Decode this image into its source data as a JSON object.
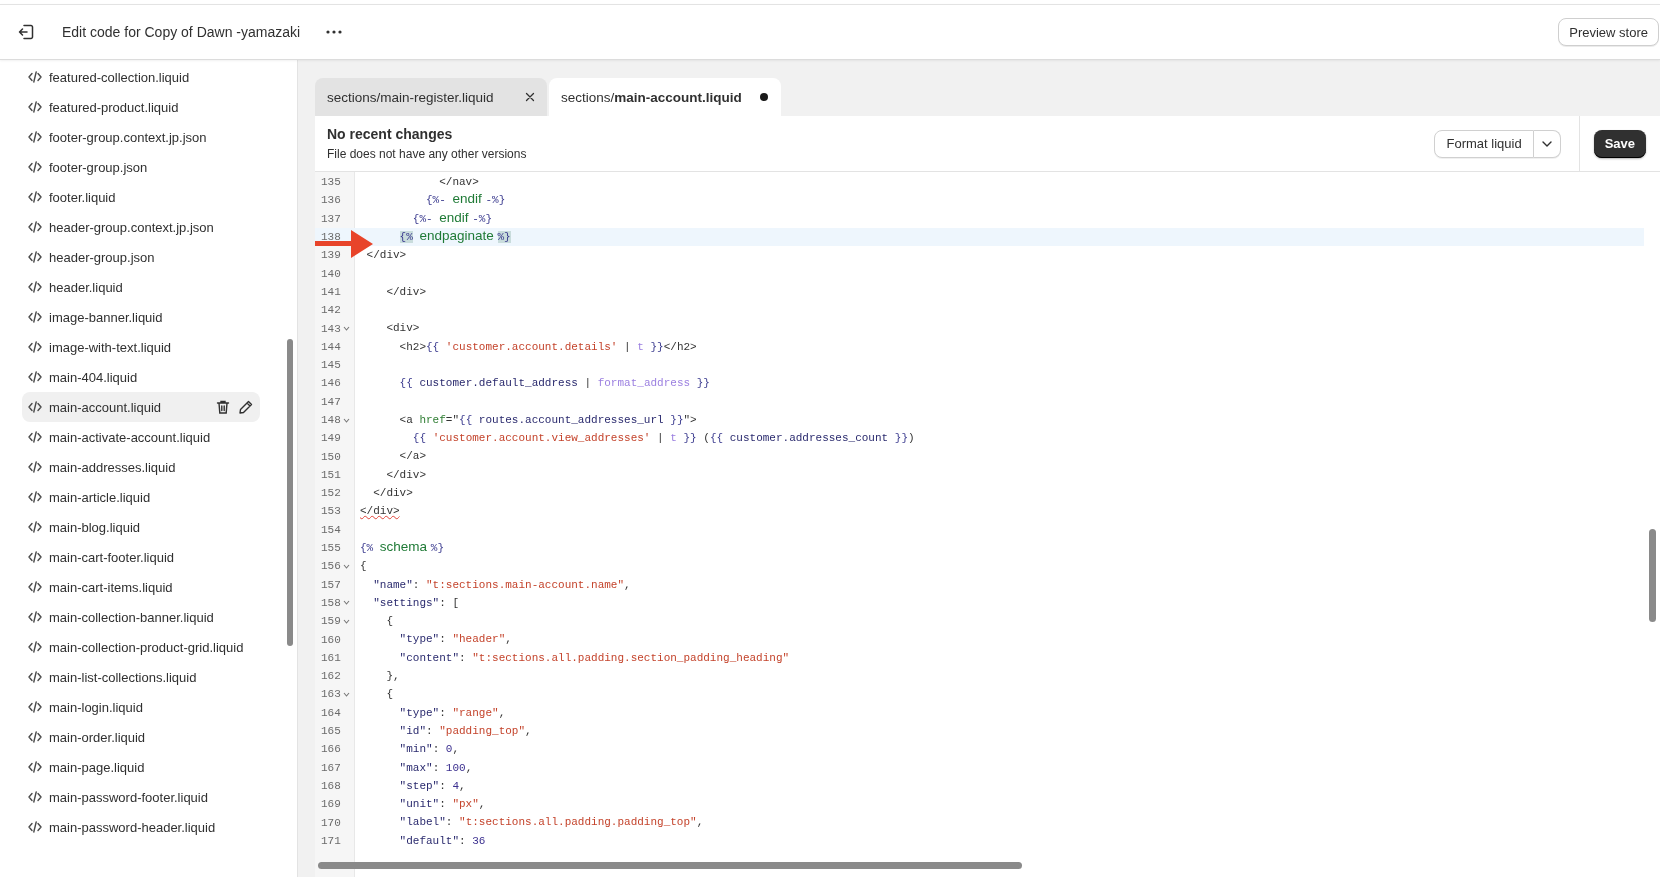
{
  "top_bar": {
    "title": "Edit code for Copy of Dawn -yamazaki",
    "preview_button": "Preview store"
  },
  "sidebar": {
    "items": [
      {
        "label": "featured-collection.liquid",
        "selected": false
      },
      {
        "label": "featured-product.liquid",
        "selected": false
      },
      {
        "label": "footer-group.context.jp.json",
        "selected": false
      },
      {
        "label": "footer-group.json",
        "selected": false
      },
      {
        "label": "footer.liquid",
        "selected": false
      },
      {
        "label": "header-group.context.jp.json",
        "selected": false
      },
      {
        "label": "header-group.json",
        "selected": false
      },
      {
        "label": "header.liquid",
        "selected": false
      },
      {
        "label": "image-banner.liquid",
        "selected": false
      },
      {
        "label": "image-with-text.liquid",
        "selected": false
      },
      {
        "label": "main-404.liquid",
        "selected": false
      },
      {
        "label": "main-account.liquid",
        "selected": true
      },
      {
        "label": "main-activate-account.liquid",
        "selected": false
      },
      {
        "label": "main-addresses.liquid",
        "selected": false
      },
      {
        "label": "main-article.liquid",
        "selected": false
      },
      {
        "label": "main-blog.liquid",
        "selected": false
      },
      {
        "label": "main-cart-footer.liquid",
        "selected": false
      },
      {
        "label": "main-cart-items.liquid",
        "selected": false
      },
      {
        "label": "main-collection-banner.liquid",
        "selected": false
      },
      {
        "label": "main-collection-product-grid.liquid",
        "selected": false
      },
      {
        "label": "main-list-collections.liquid",
        "selected": false
      },
      {
        "label": "main-login.liquid",
        "selected": false
      },
      {
        "label": "main-order.liquid",
        "selected": false
      },
      {
        "label": "main-page.liquid",
        "selected": false
      },
      {
        "label": "main-password-footer.liquid",
        "selected": false
      },
      {
        "label": "main-password-header.liquid",
        "selected": false
      }
    ]
  },
  "tabs": [
    {
      "label": "sections/main-register.liquid",
      "selected": false,
      "unsaved": false
    },
    {
      "label": "sections/**main-account.liquid**",
      "selected": true,
      "unsaved": true
    }
  ],
  "info": {
    "title": "No recent changes",
    "subtitle": "File does not have any other versions",
    "format_button": "Format liquid",
    "save_button": "Save"
  },
  "lines": [
    {
      "number": "135",
      "foldable": false,
      "highlighted": false,
      "tokens": [
        {
          "text": "            </nav>",
          "kind": "tag"
        }
      ]
    },
    {
      "number": "136",
      "foldable": false,
      "highlighted": false,
      "tokens": [
        {
          "text": "          {%-",
          "kind": "delim"
        },
        {
          "text": " endif ",
          "kind": "kw"
        },
        {
          "text": "-%}",
          "kind": "delim"
        }
      ]
    },
    {
      "number": "137",
      "foldable": false,
      "highlighted": false,
      "tokens": [
        {
          "text": "        {%-",
          "kind": "delim"
        },
        {
          "text": " endif ",
          "kind": "kw"
        },
        {
          "text": "-%}",
          "kind": "delim"
        }
      ]
    },
    {
      "number": "138",
      "foldable": false,
      "highlighted": true,
      "tokens": [
        {
          "text": "      {%",
          "kind": "match"
        },
        {
          "text": " endpaginate ",
          "kind": "kw"
        },
        {
          "text": "%}",
          "kind": "match"
        }
      ]
    },
    {
      "number": "139",
      "foldable": false,
      "highlighted": false,
      "tokens": [
        {
          "text": " </div>",
          "kind": "tag"
        }
      ]
    },
    {
      "number": "140",
      "foldable": false,
      "highlighted": false
    },
    {
      "number": "141",
      "foldable": false,
      "highlighted": false,
      "tokens": [
        {
          "text": "    </div>",
          "kind": "tag"
        }
      ]
    },
    {
      "number": "142",
      "foldable": false,
      "highlighted": false
    },
    {
      "number": "143",
      "foldable": true,
      "highlighted": false,
      "tokens": [
        {
          "text": "    <div>",
          "kind": "tag"
        }
      ]
    },
    {
      "number": "144",
      "foldable": false,
      "highlighted": false,
      "tokens": [
        {
          "text": "      <h2>",
          "kind": "tag"
        },
        {
          "text": "{{ ",
          "kind": "delim"
        },
        {
          "text": "'customer.account.details'",
          "kind": "str"
        },
        {
          "text": " | ",
          "kind": "punct"
        },
        {
          "text": "t",
          "kind": "filter"
        },
        {
          "text": " }}",
          "kind": "delim"
        },
        {
          "text": "</h2>",
          "kind": "tag"
        }
      ]
    },
    {
      "number": "145",
      "foldable": false,
      "highlighted": false
    },
    {
      "number": "146",
      "foldable": false,
      "highlighted": false,
      "tokens": [
        {
          "text": "      {{ ",
          "kind": "delim"
        },
        {
          "text": "customer.default_address",
          "kind": "var"
        },
        {
          "text": " | ",
          "kind": "punct"
        },
        {
          "text": "format_address",
          "kind": "filter"
        },
        {
          "text": " }}",
          "kind": "delim"
        }
      ]
    },
    {
      "number": "147",
      "foldable": false,
      "highlighted": false
    },
    {
      "number": "148",
      "foldable": true,
      "highlighted": false,
      "tokens": [
        {
          "text": "      <a ",
          "kind": "tag"
        },
        {
          "text": "href",
          "kind": "attr"
        },
        {
          "text": "=\"",
          "kind": "tag"
        },
        {
          "text": "{{ ",
          "kind": "delim"
        },
        {
          "text": "routes.account_addresses_url",
          "kind": "var"
        },
        {
          "text": " }}",
          "kind": "delim"
        },
        {
          "text": "\">",
          "kind": "tag"
        }
      ]
    },
    {
      "number": "149",
      "foldable": false,
      "highlighted": false,
      "tokens": [
        {
          "text": "        {{ ",
          "kind": "delim"
        },
        {
          "text": "'customer.account.view_addresses'",
          "kind": "str"
        },
        {
          "text": " | ",
          "kind": "punct"
        },
        {
          "text": "t",
          "kind": "filter"
        },
        {
          "text": " }}",
          "kind": "delim"
        },
        {
          "text": " (",
          "kind": "punct"
        },
        {
          "text": "{{ ",
          "kind": "delim"
        },
        {
          "text": "customer.addresses_count",
          "kind": "var"
        },
        {
          "text": " }}",
          "kind": "delim"
        },
        {
          "text": ")",
          "kind": "punct"
        }
      ]
    },
    {
      "number": "150",
      "foldable": false,
      "highlighted": false,
      "tokens": [
        {
          "text": "      </a>",
          "kind": "tag"
        }
      ]
    },
    {
      "number": "151",
      "foldable": false,
      "highlighted": false,
      "tokens": [
        {
          "text": "    </div>",
          "kind": "tag"
        }
      ]
    },
    {
      "number": "152",
      "foldable": false,
      "highlighted": false,
      "tokens": [
        {
          "text": "  </div>",
          "kind": "tag"
        }
      ]
    },
    {
      "number": "153",
      "foldable": false,
      "highlighted": false,
      "tokens": [
        {
          "text": "</div>",
          "kind": "err"
        }
      ]
    },
    {
      "number": "154",
      "foldable": false,
      "highlighted": false
    },
    {
      "number": "155",
      "foldable": false,
      "highlighted": false,
      "tokens": [
        {
          "text": "{%",
          "kind": "delim"
        },
        {
          "text": " schema ",
          "kind": "kw"
        },
        {
          "text": "%}",
          "kind": "delim"
        }
      ]
    },
    {
      "number": "156",
      "foldable": true,
      "highlighted": false,
      "tokens": [
        {
          "text": "{",
          "kind": "punct"
        }
      ]
    },
    {
      "number": "157",
      "foldable": false,
      "highlighted": false,
      "tokens": [
        {
          "text": "  \"name\"",
          "kind": "var"
        },
        {
          "text": ": ",
          "kind": "punct"
        },
        {
          "text": "\"t:sections.main-account.name\"",
          "kind": "str"
        },
        {
          "text": ",",
          "kind": "punct"
        }
      ]
    },
    {
      "number": "158",
      "foldable": true,
      "highlighted": false,
      "tokens": [
        {
          "text": "  \"settings\"",
          "kind": "var"
        },
        {
          "text": ": [",
          "kind": "punct"
        }
      ]
    },
    {
      "number": "159",
      "foldable": true,
      "highlighted": false,
      "tokens": [
        {
          "text": "    {",
          "kind": "punct"
        }
      ]
    },
    {
      "number": "160",
      "foldable": false,
      "highlighted": false,
      "tokens": [
        {
          "text": "      \"type\"",
          "kind": "var"
        },
        {
          "text": ": ",
          "kind": "punct"
        },
        {
          "text": "\"header\"",
          "kind": "str"
        },
        {
          "text": ",",
          "kind": "punct"
        }
      ]
    },
    {
      "number": "161",
      "foldable": false,
      "highlighted": false,
      "tokens": [
        {
          "text": "      \"content\"",
          "kind": "var"
        },
        {
          "text": ": ",
          "kind": "punct"
        },
        {
          "text": "\"t:sections.all.padding.section_padding_heading\"",
          "kind": "str"
        }
      ]
    },
    {
      "number": "162",
      "foldable": false,
      "highlighted": false,
      "tokens": [
        {
          "text": "    },",
          "kind": "punct"
        }
      ]
    },
    {
      "number": "163",
      "foldable": true,
      "highlighted": false,
      "tokens": [
        {
          "text": "    {",
          "kind": "punct"
        }
      ]
    },
    {
      "number": "164",
      "foldable": false,
      "highlighted": false,
      "tokens": [
        {
          "text": "      \"type\"",
          "kind": "var"
        },
        {
          "text": ": ",
          "kind": "punct"
        },
        {
          "text": "\"range\"",
          "kind": "str"
        },
        {
          "text": ",",
          "kind": "punct"
        }
      ]
    },
    {
      "number": "165",
      "foldable": false,
      "highlighted": false,
      "tokens": [
        {
          "text": "      \"id\"",
          "kind": "var"
        },
        {
          "text": ": ",
          "kind": "punct"
        },
        {
          "text": "\"padding_top\"",
          "kind": "str"
        },
        {
          "text": ",",
          "kind": "punct"
        }
      ]
    },
    {
      "number": "166",
      "foldable": false,
      "highlighted": false,
      "tokens": [
        {
          "text": "      \"min\"",
          "kind": "var"
        },
        {
          "text": ": ",
          "kind": "punct"
        },
        {
          "text": "0",
          "kind": "num"
        },
        {
          "text": ",",
          "kind": "punct"
        }
      ]
    },
    {
      "number": "167",
      "foldable": false,
      "highlighted": false,
      "tokens": [
        {
          "text": "      \"max\"",
          "kind": "var"
        },
        {
          "text": ": ",
          "kind": "punct"
        },
        {
          "text": "100",
          "kind": "num"
        },
        {
          "text": ",",
          "kind": "punct"
        }
      ]
    },
    {
      "number": "168",
      "foldable": false,
      "highlighted": false,
      "tokens": [
        {
          "text": "      \"step\"",
          "kind": "var"
        },
        {
          "text": ": ",
          "kind": "punct"
        },
        {
          "text": "4",
          "kind": "num"
        },
        {
          "text": ",",
          "kind": "punct"
        }
      ]
    },
    {
      "number": "169",
      "foldable": false,
      "highlighted": false,
      "tokens": [
        {
          "text": "      \"unit\"",
          "kind": "var"
        },
        {
          "text": ": ",
          "kind": "punct"
        },
        {
          "text": "\"px\"",
          "kind": "str"
        },
        {
          "text": ",",
          "kind": "punct"
        }
      ]
    },
    {
      "number": "170",
      "foldable": false,
      "highlighted": false,
      "tokens": [
        {
          "text": "      \"label\"",
          "kind": "var"
        },
        {
          "text": ": ",
          "kind": "punct"
        },
        {
          "text": "\"t:sections.all.padding.padding_top\"",
          "kind": "str"
        },
        {
          "text": ",",
          "kind": "punct"
        }
      ]
    },
    {
      "number": "171",
      "foldable": false,
      "highlighted": false,
      "tokens": [
        {
          "text": "      \"default\"",
          "kind": "var"
        },
        {
          "text": ": ",
          "kind": "punct"
        },
        {
          "text": "36",
          "kind": "num"
        }
      ]
    }
  ]
}
